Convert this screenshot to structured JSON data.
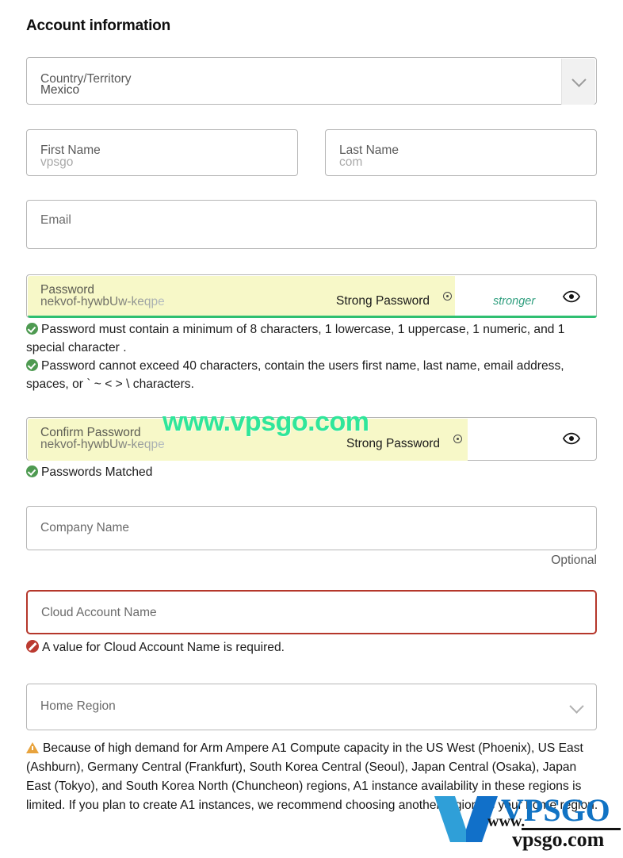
{
  "page": {
    "title": "Account information"
  },
  "country": {
    "label": "Country/Territory",
    "value": "Mexico",
    "chevron_icon": "chevron-down-icon"
  },
  "first_name": {
    "label": "First Name",
    "value": "vpsgo"
  },
  "last_name": {
    "label": "Last Name",
    "value": "com"
  },
  "email": {
    "placeholder": "Email",
    "value": ""
  },
  "password": {
    "label": "Password",
    "value": "nekvof-hywbUw-keqpe",
    "autofill_hint": "Strong Password",
    "strength_text": "stronger",
    "reveal_icon": "eye-icon",
    "key_icon": "key-badge-icon",
    "strength_color": "#2fbf71",
    "autofill_color": "#f7f8c8"
  },
  "password_hints": [
    {
      "icon": "check-circle-icon",
      "text": "Password must contain a minimum of 8 characters, 1 lowercase, 1 uppercase, 1 numeric, and 1 special character ."
    },
    {
      "icon": "check-circle-icon",
      "text": "Password cannot exceed 40 characters, contain the users first name, last name, email address, spaces, or ` ~ < > \\ characters."
    }
  ],
  "confirm_password": {
    "label": "Confirm Password",
    "value": "nekvof-hywbUw-keqpe",
    "autofill_hint": "Strong Password",
    "reveal_icon": "eye-icon",
    "match_icon": "check-circle-icon",
    "match_text": "Passwords Matched"
  },
  "company": {
    "placeholder": "Company Name",
    "value": "",
    "optional_text": "Optional"
  },
  "cloud_account": {
    "placeholder": "Cloud Account Name",
    "value": "",
    "error_icon": "error-circle-icon",
    "error_text": "A value for Cloud Account Name is required.",
    "error_color": "#b5372b"
  },
  "home_region": {
    "placeholder": "Home Region",
    "value": "",
    "chevron_icon": "chevron-down-icon"
  },
  "region_warning": {
    "icon": "warning-triangle-icon",
    "text": "Because of high demand for Arm Ampere A1 Compute capacity in the US West (Phoenix), US East (Ashburn), Germany Central (Frankfurt), South Korea Central (Seoul), Japan Central (Osaka), Japan East (Tokyo), and South Korea North (Chuncheon) regions, A1 instance availability in these regions is limited. If you plan to create A1 instances, we recommend choosing another region as your home region.",
    "color": "#e8a33d"
  },
  "watermark": {
    "text": "www.vpsgo.com",
    "text_color": "#2fe69a",
    "logo_name": "VPSGO",
    "logo_www": "www.",
    "logo_domain": "vpsgo.com",
    "logo_color": "#1173c4"
  }
}
